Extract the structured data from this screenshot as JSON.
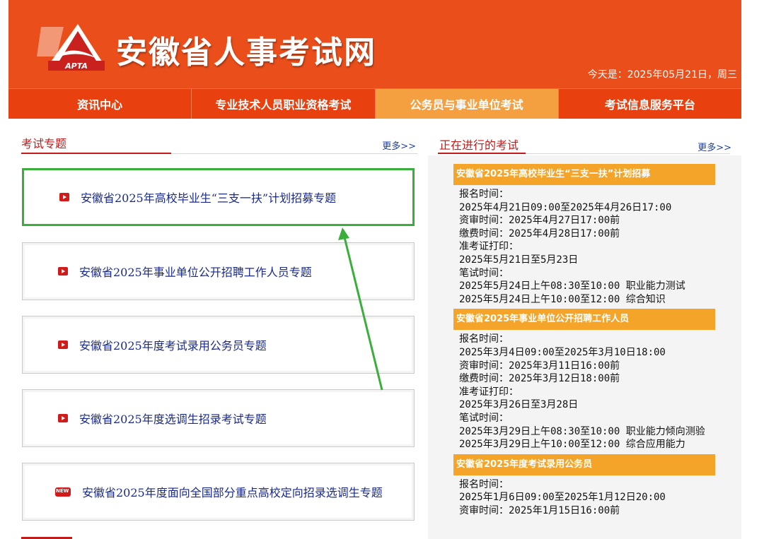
{
  "header": {
    "site_title": "安徽省人事考试网",
    "logo_text": "APTA",
    "date_text": "今天是：2025年05月21日，周三"
  },
  "nav": {
    "items": [
      {
        "label": "资讯中心"
      },
      {
        "label": "专业技术人员职业资格考试"
      },
      {
        "label": "公务员与事业单位考试"
      },
      {
        "label": "考试信息服务平台"
      }
    ],
    "active_index": 2
  },
  "topics_section": {
    "title": "考试专题",
    "more": "更多>>",
    "items": [
      {
        "label": "安徽省2025年高校毕业生“三支一扶”计划招募专题",
        "icon": "play-icon"
      },
      {
        "label": "安徽省2025年事业单位公开招聘工作人员专题",
        "icon": "play-icon"
      },
      {
        "label": "安徽省2025年度考试录用公务员专题",
        "icon": "play-icon"
      },
      {
        "label": "安徽省2025年度选调生招录考试专题",
        "icon": "play-icon"
      },
      {
        "label": "安徽省2025年度面向全国部分重点高校定向招录选调生专题",
        "icon": "new-icon"
      }
    ]
  },
  "ongoing_section": {
    "title": "正在进行的考试",
    "more": "更多>>",
    "exams": [
      {
        "title": "安徽省2025年高校毕业生“三支一扶”计划招募",
        "lines": [
          "报名时间：",
          "2025年4月21日09:00至2025年4月26日17:00",
          "资审时间：2025年4月27日17:00前",
          "缴费时间：2025年4月28日17:00前",
          "准考证打印：",
          "2025年5月21日至5月23日",
          "笔试时间：",
          "2025年5月24日上午08:30至10:00 职业能力测试",
          "2025年5月24日上午10:00至12:00 综合知识"
        ]
      },
      {
        "title": "安徽省2025年事业单位公开招聘工作人员",
        "lines": [
          "报名时间：",
          "2025年3月4日09:00至2025年3月10日18:00",
          "资审时间：2025年3月11日16:00前",
          "缴费时间：2025年3月12日18:00前",
          "准考证打印：",
          "2025年3月26日至3月28日",
          "笔试时间：",
          "2025年3月29日上午08:30至10:00 职业能力倾向测验",
          "2025年3月29日上午10:00至12:00 综合应用能力"
        ]
      },
      {
        "title": "安徽省2025年度考试录用公务员",
        "lines": [
          "报名时间：",
          "2025年1月6日09:00至2025年1月12日20:00",
          "资审时间：2025年1月15日16:00前"
        ]
      }
    ]
  },
  "colors": {
    "header_bg": "#e94e1b",
    "nav_active": "#f5a040",
    "exam_banner": "#f4a428",
    "highlight_border": "#3aae3a",
    "link_blue": "#1a2a8c"
  }
}
